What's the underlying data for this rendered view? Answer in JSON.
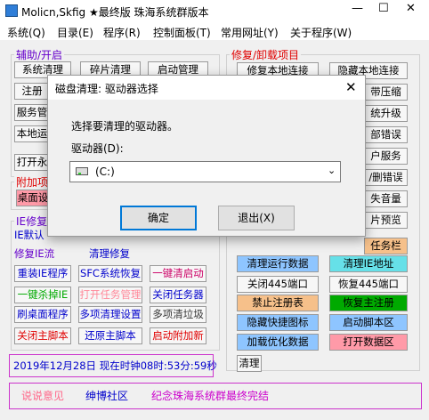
{
  "window": {
    "title": "Molicn,Skfig ★最终版 珠海系统群版本",
    "minimize": "—",
    "maximize": "☐",
    "close": "✕"
  },
  "menu": [
    "系统(Q)",
    "目录(E)",
    "程序(R)",
    "控制面板(T)",
    "常用网址(Y)",
    "关于程序(W)"
  ],
  "groups": {
    "assist": {
      "title": "辅助/开启",
      "row1": [
        "系统清理",
        "碎片清理",
        "启动管理"
      ],
      "row2": "注册",
      "row3": "服务管",
      "row4": "本地运",
      "row5": "打开永"
    },
    "repair": {
      "title": "修复/卸载项目",
      "row1": [
        "修复本地连接",
        "隐藏本地连接"
      ],
      "right_partial": [
        "带压缩",
        "统升级",
        "部错误",
        "户服务",
        "/删错误",
        "失音量",
        "片预览"
      ],
      "orange_partial": "任务栏"
    },
    "extra": {
      "title": "附加项",
      "row1": "桌面设"
    },
    "ie": {
      "title": "IE修复",
      "left_partial": [
        "IE默认",
        "修复IE流"
      ],
      "partial_row": "清理修复",
      "rows": [
        [
          "重装IE程序",
          "SFC系统恢复",
          "一键清启动"
        ],
        [
          "一键杀掉IE",
          "打开任务管理",
          "关闭任务器"
        ],
        [
          "刷桌面程序",
          "多项清理设置",
          "多项清垃圾"
        ],
        [
          "关闭主脚本",
          "还原主脚本",
          "启动附加新"
        ]
      ]
    },
    "right_buttons": [
      [
        "清理运行数据",
        "清理IE地址"
      ],
      [
        "关闭445端口",
        "恢复445端口"
      ],
      [
        "禁止注册表",
        "恢复主注册"
      ],
      [
        "隐藏快捷图标",
        "启动脚本区"
      ],
      [
        "加载优化数据",
        "打开数据区"
      ]
    ],
    "right_last": "清理"
  },
  "status": {
    "datetime": "2019年12月28日 现在时钟08时:53分:59秒"
  },
  "footer": {
    "link1": "说说意见",
    "link2": "绅博社区",
    "link3": "纪念珠海系统群最终完结"
  },
  "dialog": {
    "title": "磁盘清理: 驱动器选择",
    "prompt": "选择要清理的驱动器。",
    "drive_label": "驱动器(D):",
    "selected_drive": "(C:)",
    "ok": "确定",
    "exit": "退出(X)"
  },
  "colors": {
    "purple": "#6600cc",
    "red": "#e00000",
    "green_btn": "#00aa00",
    "pink_btn": "#ff9aa8",
    "orange_btn": "#f6c08a",
    "blue_btn": "#8ec5ff",
    "cyan_btn": "#66e0e8"
  }
}
